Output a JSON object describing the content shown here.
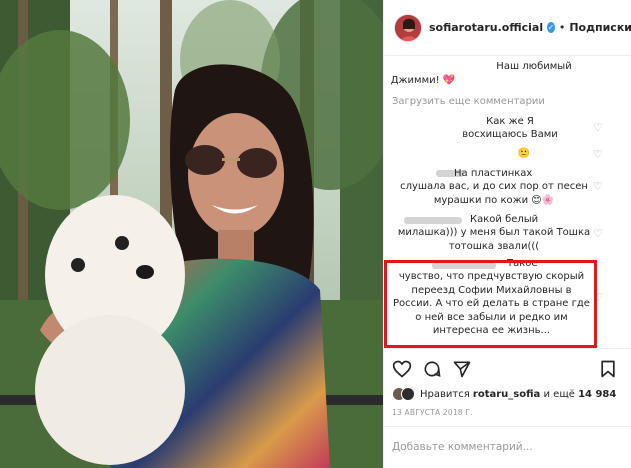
{
  "header": {
    "username": "sofiarotaru.official",
    "follow_label": "Подписки",
    "separator": "•"
  },
  "comments": {
    "first": {
      "lines": [
        "Наш любимый",
        "Джимми! 💖"
      ]
    },
    "load_more_label": "Загрузить еще комментарии",
    "items": [
      {
        "lines": [
          "Как же Я",
          "восхищаюсь Вами"
        ]
      },
      {
        "lines": [
          "🙂"
        ]
      },
      {
        "lines": [
          "На пластинках",
          "слушала вас, и до сих пор от песен",
          "мурашки по кожи 😊🌸"
        ]
      },
      {
        "lines": [
          "Какой белый",
          "милашка))) у меня был такой Тошка",
          "тотошка звали((("
        ]
      },
      {
        "lines": [
          "Такое",
          "чувство, что предчувствую скорый",
          "переезд Софии Михайловны в",
          "России. А что ей делать в стране где",
          "о ней все забыли и редко им",
          "интересна ее жизнь..."
        ]
      }
    ]
  },
  "actions": {
    "icons": [
      "heart-icon",
      "comment-icon",
      "share-icon",
      "bookmark-icon"
    ]
  },
  "likes": {
    "prefix": "Нравится",
    "user": "rotaru_sofia",
    "middle": "и ещё",
    "count": "14 984"
  },
  "date": "13 АВГУСТА 2018 Г.",
  "add_comment": {
    "placeholder": "Добавьте комментарий..."
  },
  "colors": {
    "highlight": "#e3161b",
    "verified": "#3897f0",
    "muted": "#999999"
  }
}
